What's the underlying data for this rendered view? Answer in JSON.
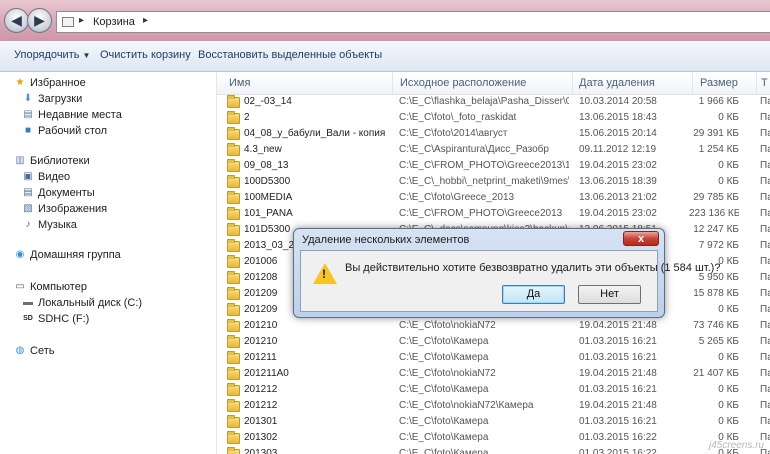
{
  "address": {
    "location": "Корзина",
    "back_glyph": "◀",
    "forward_glyph": "▶"
  },
  "toolbar": {
    "organize": "Упорядочить",
    "empty_bin": "Очистить корзину",
    "restore_selected": "Восстановить выделенные объекты"
  },
  "nav": {
    "favorites": "Избранное",
    "downloads": "Загрузки",
    "recent_places": "Недавние места",
    "desktop": "Рабочий стол",
    "libraries": "Библиотеки",
    "video": "Видео",
    "documents": "Документы",
    "images": "Изображения",
    "music": "Музыка",
    "homegroup": "Домашняя группа",
    "computer": "Компьютер",
    "local_disk": "Локальный диск (C:)",
    "sdhc": "SDHC (F:)",
    "network": "Сеть"
  },
  "columns": {
    "name": "Имя",
    "origin": "Исходное расположение",
    "deleted": "Дата удаления",
    "size": "Размер",
    "extra": "Т"
  },
  "rows": [
    {
      "name": "02_-03_14",
      "path": "C:\\E_C\\flashka_belaja\\Pasha_Disser\\04_0...",
      "date": "10.03.2014 20:58",
      "size": "1 966 КБ",
      "extra": "Па"
    },
    {
      "name": "2",
      "path": "C:\\E_C\\foto\\_foto_raskidat",
      "date": "13.06.2015 18:43",
      "size": "0 КБ",
      "extra": "Па"
    },
    {
      "name": "04_08_у_бабули_Вали - копия",
      "path": "C:\\E_C\\foto\\2014\\август",
      "date": "15.06.2015 20:14",
      "size": "29 391 КБ",
      "extra": "Па"
    },
    {
      "name": "4.3_new",
      "path": "C:\\E_C\\Aspirantura\\Дисс_Разобр",
      "date": "09.11.2012 12:19",
      "size": "1 254 КБ",
      "extra": "Па"
    },
    {
      "name": "09_08_13",
      "path": "C:\\E_C\\FROM_PHOTO\\Greece2013\\102_...",
      "date": "19.04.2015 23:02",
      "size": "0 КБ",
      "extra": "Па"
    },
    {
      "name": "100D5300",
      "path": "C:\\E_C\\_hobbi\\_netprint_maketi\\9mes\\...",
      "date": "13.06.2015 18:39",
      "size": "0 КБ",
      "extra": "Па"
    },
    {
      "name": "100MEDIA",
      "path": "C:\\E_C\\foto\\Greece_2013",
      "date": "13.06.2013 21:02",
      "size": "29 785 КБ",
      "extra": "Па"
    },
    {
      "name": "101_PANA",
      "path": "C:\\E_C\\FROM_PHOTO\\Greece2013",
      "date": "19.04.2015 23:02",
      "size": "223 136 КБ",
      "extra": "Па"
    },
    {
      "name": "101D5300",
      "path": "C:\\E_C\\_docs\\samsung\\kies3\\backup\\S...",
      "date": "13.06.2015 18:51",
      "size": "12 247 КБ",
      "extra": "Па"
    },
    {
      "name": "2013_03_26_(",
      "path": "",
      "date": "",
      "size": "7 972 КБ",
      "extra": "Па"
    },
    {
      "name": "201006",
      "path": "",
      "date": "",
      "size": "0 КБ",
      "extra": "Па"
    },
    {
      "name": "201208",
      "path": "",
      "date": "",
      "size": "5 950 КБ",
      "extra": "Па"
    },
    {
      "name": "201209",
      "path": "",
      "date": "",
      "size": "15 878 КБ",
      "extra": "Па"
    },
    {
      "name": "201209",
      "path": "",
      "date": "",
      "size": "0 КБ",
      "extra": "Па"
    },
    {
      "name": "201210",
      "path": "C:\\E_C\\foto\\nokiaN72",
      "date": "19.04.2015 21:48",
      "size": "73 746 КБ",
      "extra": "Па"
    },
    {
      "name": "201210",
      "path": "C:\\E_C\\foto\\Камера",
      "date": "01.03.2015 16:21",
      "size": "5 265 КБ",
      "extra": "Па"
    },
    {
      "name": "201211",
      "path": "C:\\E_C\\foto\\Камера",
      "date": "01.03.2015 16:21",
      "size": "0 КБ",
      "extra": "Па"
    },
    {
      "name": "201211A0",
      "path": "C:\\E_C\\foto\\nokiaN72",
      "date": "19.04.2015 21:48",
      "size": "21 407 КБ",
      "extra": "Па"
    },
    {
      "name": "201212",
      "path": "C:\\E_C\\foto\\Камера",
      "date": "01.03.2015 16:21",
      "size": "0 КБ",
      "extra": "Па"
    },
    {
      "name": "201212",
      "path": "C:\\E_C\\foto\\nokiaN72\\Камера",
      "date": "19.04.2015 21:48",
      "size": "0 КБ",
      "extra": "Па"
    },
    {
      "name": "201301",
      "path": "C:\\E_C\\foto\\Камера",
      "date": "01.03.2015 16:21",
      "size": "0 КБ",
      "extra": "Па"
    },
    {
      "name": "201302",
      "path": "C:\\E_C\\foto\\Камера",
      "date": "01.03.2015 16:22",
      "size": "0 КБ",
      "extra": "Па"
    },
    {
      "name": "201303",
      "path": "C:\\E_C\\foto\\Камера",
      "date": "01.03.2015 16:22",
      "size": "0 КБ",
      "extra": "Па"
    }
  ],
  "dialog": {
    "title": "Удаление нескольких элементов",
    "close_glyph": "x",
    "message": "Вы действительно хотите безвозвратно удалить эти объекты (1 584 шт.)?",
    "yes": "Да",
    "no": "Нет"
  },
  "watermark": "j45creens.ru"
}
